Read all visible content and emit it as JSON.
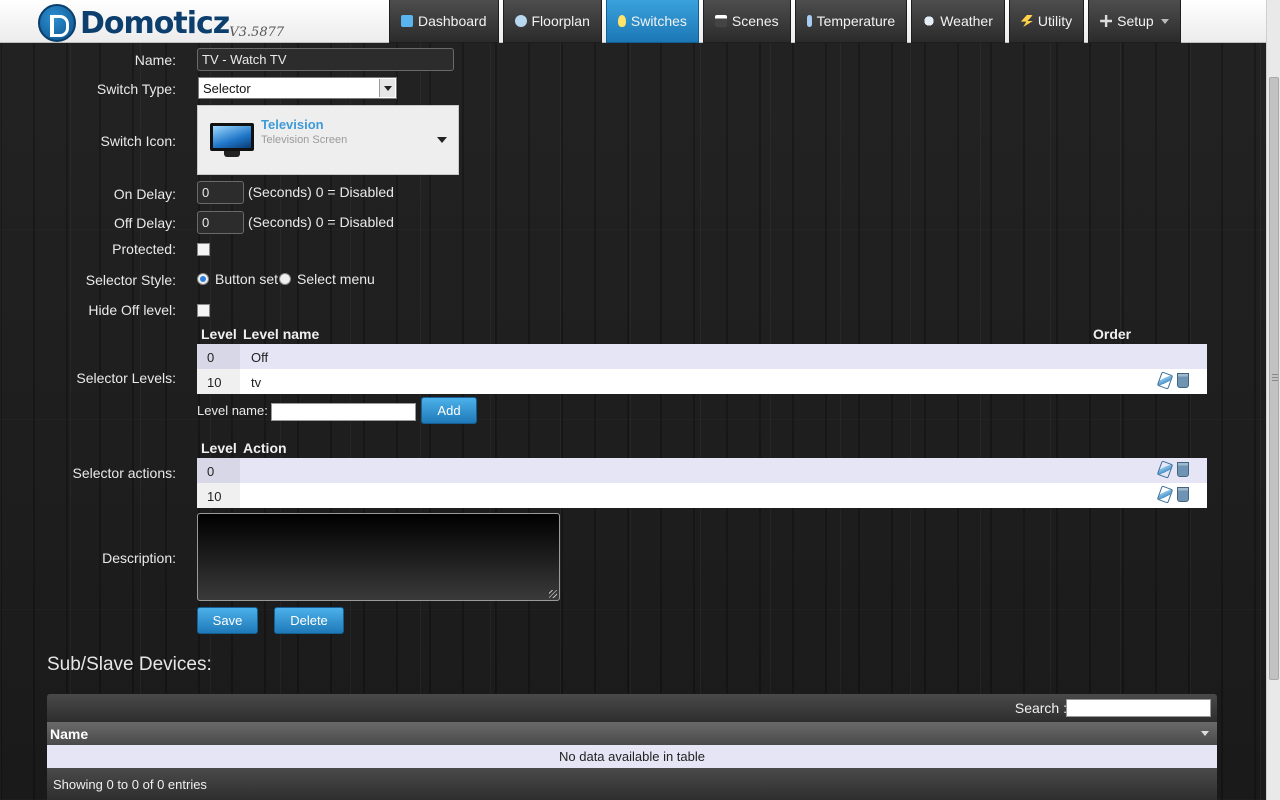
{
  "app": {
    "name": "Domoticz",
    "version": "V3.5877"
  },
  "nav": {
    "tabs": [
      {
        "label": "Dashboard",
        "icon": "dashboard-icon"
      },
      {
        "label": "Floorplan",
        "icon": "floorplan-icon"
      },
      {
        "label": "Switches",
        "icon": "lightbulb-icon",
        "active": true
      },
      {
        "label": "Scenes",
        "icon": "clapperboard-icon"
      },
      {
        "label": "Temperature",
        "icon": "thermometer-icon"
      },
      {
        "label": "Weather",
        "icon": "weather-cloud-icon"
      },
      {
        "label": "Utility",
        "icon": "utility-bolt-icon"
      },
      {
        "label": "Setup",
        "icon": "tools-icon"
      }
    ]
  },
  "form": {
    "name_label": "Name:",
    "name_value": "TV - Watch TV",
    "switch_type_label": "Switch Type:",
    "switch_type_value": "Selector",
    "switch_icon_label": "Switch Icon:",
    "switch_icon_title": "Television",
    "switch_icon_subtitle": "Television Screen",
    "on_delay_label": "On Delay:",
    "on_delay_value": "0",
    "on_delay_hint": "(Seconds) 0 = Disabled",
    "off_delay_label": "Off Delay:",
    "off_delay_value": "0",
    "off_delay_hint": "(Seconds) 0 = Disabled",
    "protected_label": "Protected:",
    "selector_style_label": "Selector Style:",
    "selector_style_options": [
      "Button set",
      "Select menu"
    ],
    "selector_style_selected": "Button set",
    "hide_off_label": "Hide Off level:",
    "selector_levels_label": "Selector Levels:",
    "levels_headers": {
      "level": "Level",
      "name": "Level name",
      "order": "Order"
    },
    "levels": [
      {
        "level": "0",
        "name": "Off"
      },
      {
        "level": "10",
        "name": "tv"
      }
    ],
    "level_name_label": "Level name:",
    "level_name_value": "",
    "add_button": "Add",
    "selector_actions_label": "Selector actions:",
    "actions_headers": {
      "level": "Level",
      "action": "Action"
    },
    "actions": [
      {
        "level": "0",
        "action": ""
      },
      {
        "level": "10",
        "action": ""
      }
    ],
    "description_label": "Description:",
    "description_value": "",
    "save_button": "Save",
    "delete_button": "Delete"
  },
  "subdevices": {
    "title": "Sub/Slave Devices:",
    "search_label": "Search :",
    "search_value": "",
    "column_name": "Name",
    "empty_text": "No data available in table",
    "info_text": "Showing 0 to 0 of 0 entries"
  },
  "colors": {
    "accent": "#2a8bcf",
    "row_odd": "#e5e5f6",
    "background": "#1e1e1e"
  }
}
